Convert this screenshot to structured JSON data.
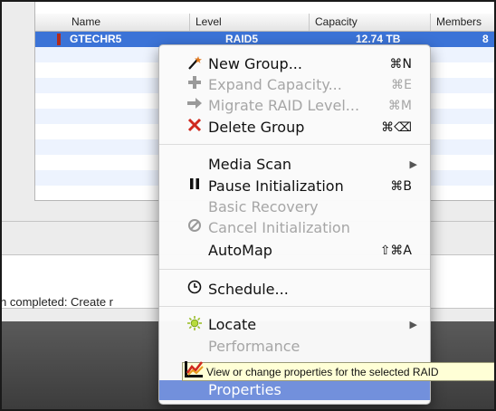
{
  "table": {
    "columns": [
      "Name",
      "Level",
      "Capacity",
      "Members"
    ],
    "selected_row": {
      "name": "GTECHR5",
      "level": "RAID5",
      "capacity": "12.74 TB",
      "members": "8"
    }
  },
  "status": {
    "text": "n completed: Create r"
  },
  "context_menu": {
    "items": [
      {
        "label": "New Group...",
        "shortcut": "⌘N",
        "icon": "wand-icon",
        "enabled": true
      },
      {
        "label": "Expand Capacity...",
        "shortcut": "⌘E",
        "icon": "plus-icon",
        "enabled": false
      },
      {
        "label": "Migrate RAID Level...",
        "shortcut": "⌘M",
        "icon": "arrow-right-icon",
        "enabled": false
      },
      {
        "label": "Delete Group",
        "shortcut": "⌘⌫",
        "icon": "red-x-icon",
        "enabled": true
      },
      {
        "label": "Media Scan",
        "icon": "",
        "enabled": true,
        "submenu": true
      },
      {
        "label": "Pause Initialization",
        "shortcut": "⌘B",
        "icon": "pause-icon",
        "enabled": true
      },
      {
        "label": "Basic Recovery",
        "icon": "",
        "enabled": false
      },
      {
        "label": "Cancel Initialization",
        "icon": "cancel-icon",
        "enabled": false
      },
      {
        "label": "AutoMap",
        "shortcut": "⇧⌘A",
        "icon": "",
        "enabled": true
      },
      {
        "label": "Schedule...",
        "icon": "clock-icon",
        "enabled": true
      },
      {
        "label": "Locate",
        "icon": "locate-sun-icon",
        "enabled": true,
        "submenu": true
      },
      {
        "label": "Performance",
        "icon": "",
        "enabled": false
      },
      {
        "label": "Properties",
        "icon": "",
        "enabled": true,
        "highlighted": true
      }
    ]
  },
  "tooltip": {
    "text": "View or change properties for the selected RAID"
  },
  "colors": {
    "selection": "#3b73d7",
    "menu_highlight": "#7290dc",
    "delete_red": "#d0281e",
    "tooltip_bg": "#ffffd6"
  }
}
